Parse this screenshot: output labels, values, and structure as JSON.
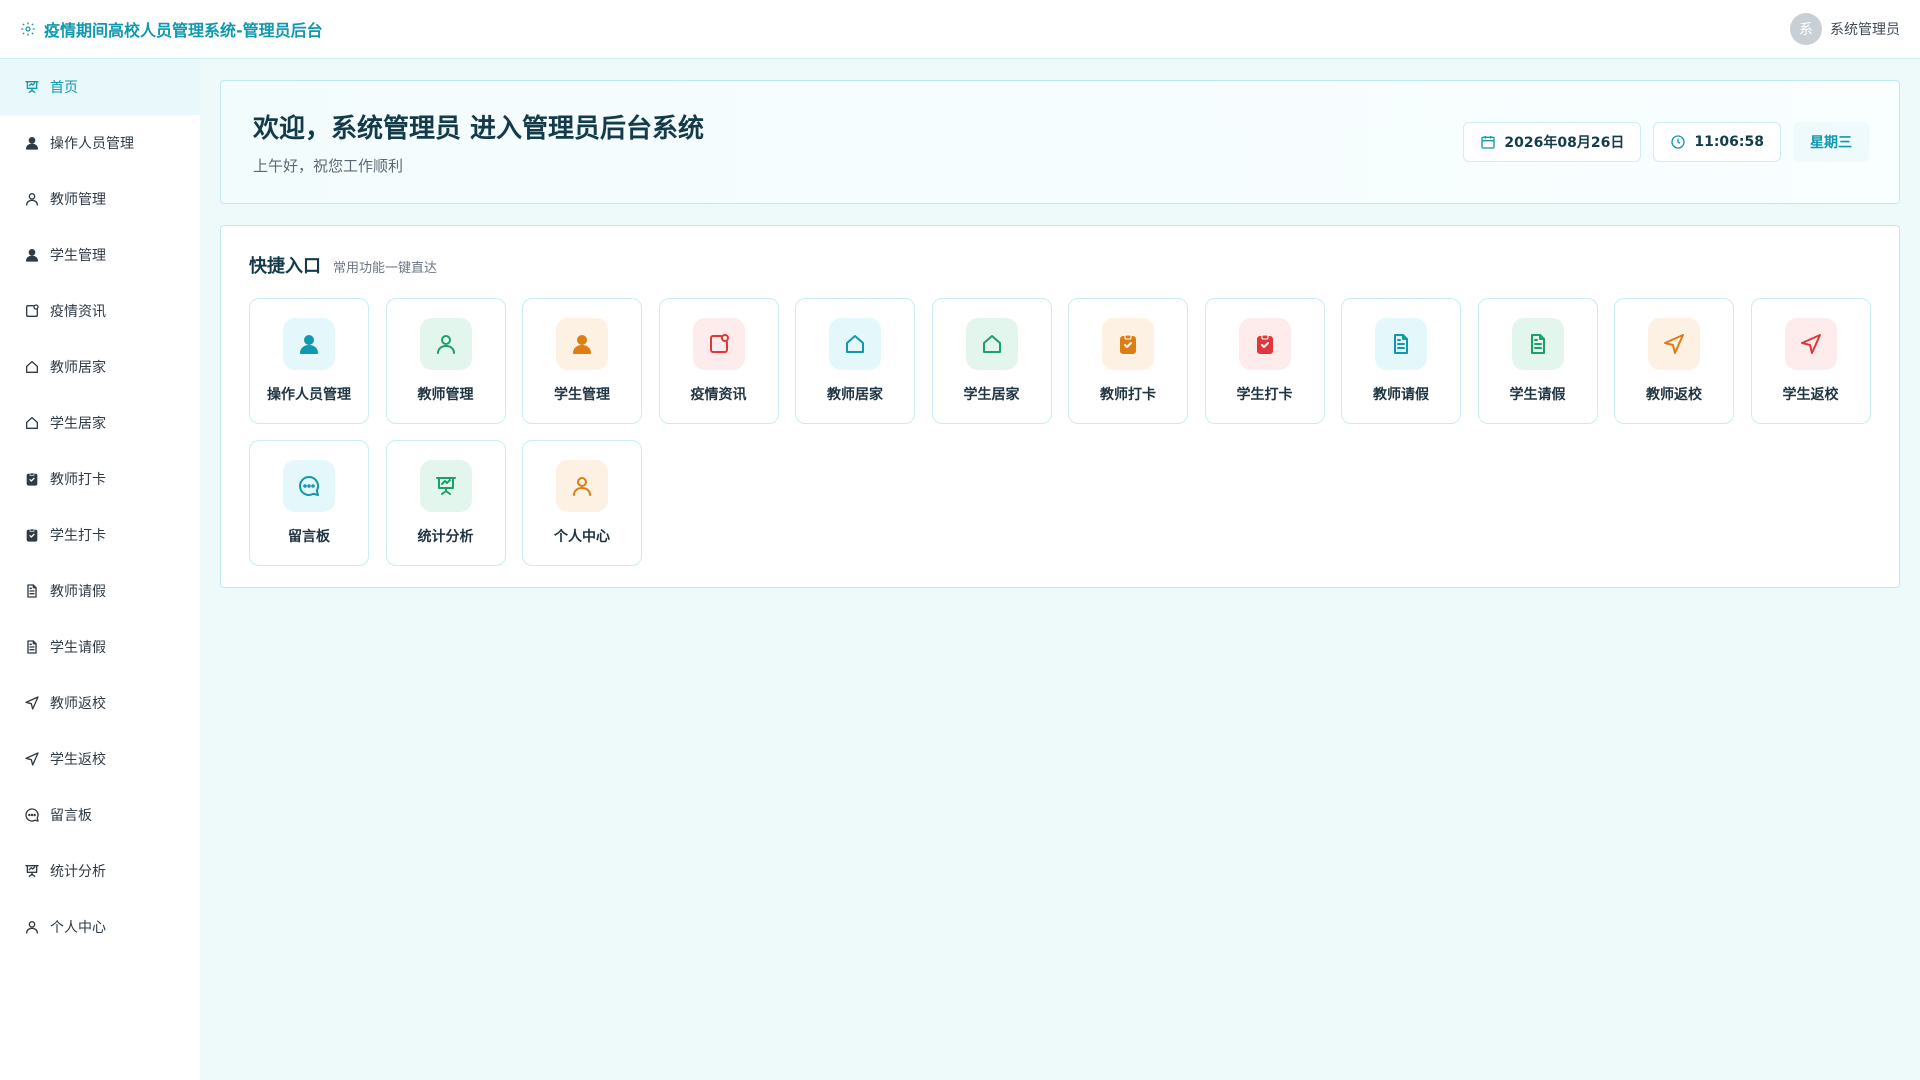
{
  "header": {
    "title": "疫情期间高校人员管理系统-管理员后台",
    "avatar_char": "系",
    "user_name": "系统管理员"
  },
  "sidebar": {
    "items": [
      {
        "label": "首页",
        "icon": "home-board-icon",
        "active": true
      },
      {
        "label": "操作人员管理",
        "icon": "user-solid-icon"
      },
      {
        "label": "教师管理",
        "icon": "user-outline-icon"
      },
      {
        "label": "学生管理",
        "icon": "user-solid-icon"
      },
      {
        "label": "疫情资讯",
        "icon": "news-icon"
      },
      {
        "label": "教师居家",
        "icon": "house-icon"
      },
      {
        "label": "学生居家",
        "icon": "house-icon"
      },
      {
        "label": "教师打卡",
        "icon": "clipboard-check-icon"
      },
      {
        "label": "学生打卡",
        "icon": "clipboard-check-icon"
      },
      {
        "label": "教师请假",
        "icon": "document-icon"
      },
      {
        "label": "学生请假",
        "icon": "document-icon"
      },
      {
        "label": "教师返校",
        "icon": "navigation-icon"
      },
      {
        "label": "学生返校",
        "icon": "navigation-icon"
      },
      {
        "label": "留言板",
        "icon": "chat-icon"
      },
      {
        "label": "统计分析",
        "icon": "presentation-icon"
      },
      {
        "label": "个人中心",
        "icon": "user-outline-icon"
      }
    ]
  },
  "welcome": {
    "title": "欢迎，系统管理员 进入管理员后台系统",
    "subtitle": "上午好，祝您工作顺利",
    "date": "2026年08月26日",
    "time": "11:06:58",
    "weekday": "星期三"
  },
  "quick": {
    "title": "快捷入口",
    "subtitle": "常用功能一键直达",
    "cards": [
      {
        "label": "操作人员管理",
        "icon": "user-solid-icon",
        "color": "teal"
      },
      {
        "label": "教师管理",
        "icon": "user-outline-icon",
        "color": "green"
      },
      {
        "label": "学生管理",
        "icon": "user-solid-icon",
        "color": "orange"
      },
      {
        "label": "疫情资讯",
        "icon": "news-icon",
        "color": "red"
      },
      {
        "label": "教师居家",
        "icon": "house-icon",
        "color": "teal"
      },
      {
        "label": "学生居家",
        "icon": "house-icon",
        "color": "green"
      },
      {
        "label": "教师打卡",
        "icon": "clipboard-check-icon",
        "color": "orange"
      },
      {
        "label": "学生打卡",
        "icon": "clipboard-check-icon",
        "color": "red"
      },
      {
        "label": "教师请假",
        "icon": "document-icon",
        "color": "teal"
      },
      {
        "label": "学生请假",
        "icon": "document-icon",
        "color": "green"
      },
      {
        "label": "教师返校",
        "icon": "navigation-icon",
        "color": "orange"
      },
      {
        "label": "学生返校",
        "icon": "navigation-icon",
        "color": "red"
      },
      {
        "label": "留言板",
        "icon": "chat-icon",
        "color": "teal"
      },
      {
        "label": "统计分析",
        "icon": "presentation-icon",
        "color": "green"
      },
      {
        "label": "个人中心",
        "icon": "user-outline-icon",
        "color": "orange"
      }
    ]
  },
  "colors": {
    "accent": "#1298ae",
    "teal": "#1298ae",
    "green": "#1e9e6a",
    "orange": "#dd7d12",
    "red": "#e0383a"
  }
}
